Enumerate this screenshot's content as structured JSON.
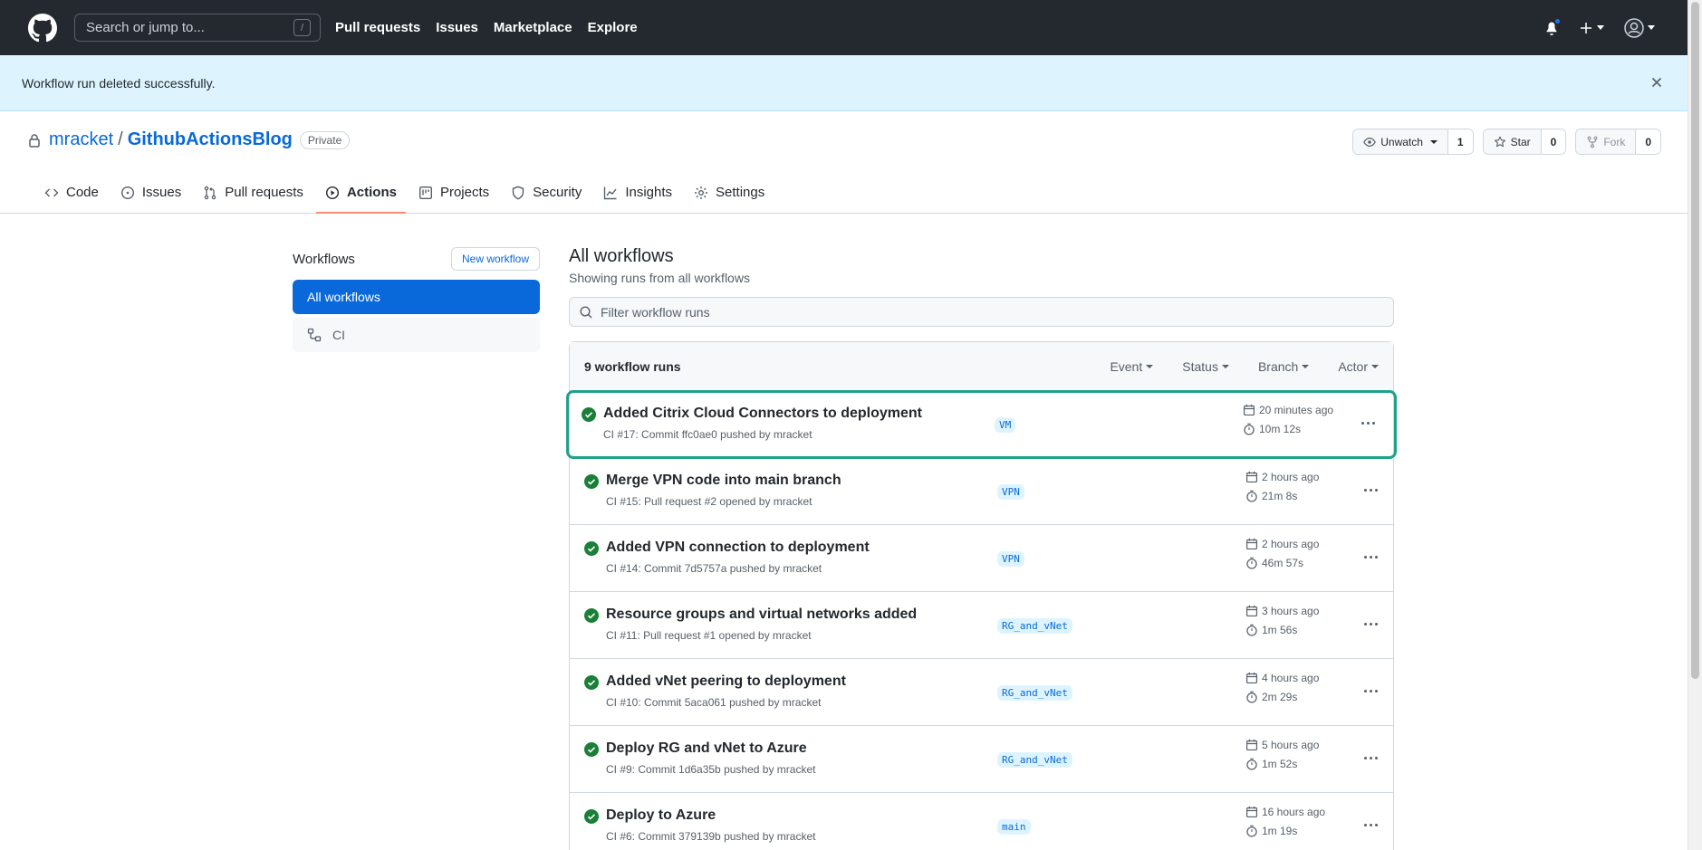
{
  "header": {
    "search_placeholder": "Search or jump to...",
    "search_key": "/",
    "nav": [
      "Pull requests",
      "Issues",
      "Marketplace",
      "Explore"
    ]
  },
  "flash": {
    "message": "Workflow run deleted successfully."
  },
  "repo": {
    "owner": "mracket",
    "separator": "/",
    "name": "GithubActionsBlog",
    "visibility": "Private",
    "watch_label": "Unwatch",
    "watch_count": "1",
    "star_label": "Star",
    "star_count": "0",
    "fork_label": "Fork",
    "fork_count": "0"
  },
  "tabs": [
    {
      "label": "Code",
      "icon": "code-icon"
    },
    {
      "label": "Issues",
      "icon": "issue-icon"
    },
    {
      "label": "Pull requests",
      "icon": "pull-request-icon"
    },
    {
      "label": "Actions",
      "icon": "play-icon",
      "selected": true
    },
    {
      "label": "Projects",
      "icon": "project-icon"
    },
    {
      "label": "Security",
      "icon": "shield-icon"
    },
    {
      "label": "Insights",
      "icon": "graph-icon"
    },
    {
      "label": "Settings",
      "icon": "gear-icon"
    }
  ],
  "sidebar": {
    "title": "Workflows",
    "new_workflow": "New workflow",
    "items": [
      {
        "label": "All workflows",
        "active": true
      },
      {
        "label": "CI",
        "icon": "workflow-icon"
      }
    ]
  },
  "main": {
    "title": "All workflows",
    "subtitle": "Showing runs from all workflows",
    "filter_placeholder": "Filter workflow runs",
    "runs_count": "9 workflow runs",
    "filters": [
      "Event",
      "Status",
      "Branch",
      "Actor"
    ],
    "runs": [
      {
        "title": "Added Citrix Cloud Connectors to deployment",
        "meta": "CI #17: Commit ffc0ae0 pushed by mracket",
        "branch": "VM",
        "when": "20 minutes ago",
        "duration": "10m 12s",
        "highlight": true
      },
      {
        "title": "Merge VPN code into main branch",
        "meta": "CI #15: Pull request #2 opened by mracket",
        "branch": "VPN",
        "when": "2 hours ago",
        "duration": "21m 8s"
      },
      {
        "title": "Added VPN connection to deployment",
        "meta": "CI #14: Commit 7d5757a pushed by mracket",
        "branch": "VPN",
        "when": "2 hours ago",
        "duration": "46m 57s"
      },
      {
        "title": "Resource groups and virtual networks added",
        "meta": "CI #11: Pull request #1 opened by mracket",
        "branch": "RG_and_vNet",
        "when": "3 hours ago",
        "duration": "1m 56s"
      },
      {
        "title": "Added vNet peering to deployment",
        "meta": "CI #10: Commit 5aca061 pushed by mracket",
        "branch": "RG_and_vNet",
        "when": "4 hours ago",
        "duration": "2m 29s"
      },
      {
        "title": "Deploy RG and vNet to Azure",
        "meta": "CI #9: Commit 1d6a35b pushed by mracket",
        "branch": "RG_and_vNet",
        "when": "5 hours ago",
        "duration": "1m 52s"
      },
      {
        "title": "Deploy to Azure",
        "meta": "CI #6: Commit 379139b pushed by mracket",
        "branch": "main",
        "when": "16 hours ago",
        "duration": "1m 19s"
      }
    ]
  },
  "colors": {
    "header_bg": "#24292f",
    "accent": "#0969da",
    "success": "#1a7f37",
    "flash_bg": "#ddf4ff",
    "tab_underline": "#fd8c73",
    "highlight_outline": "#1fa28b"
  }
}
